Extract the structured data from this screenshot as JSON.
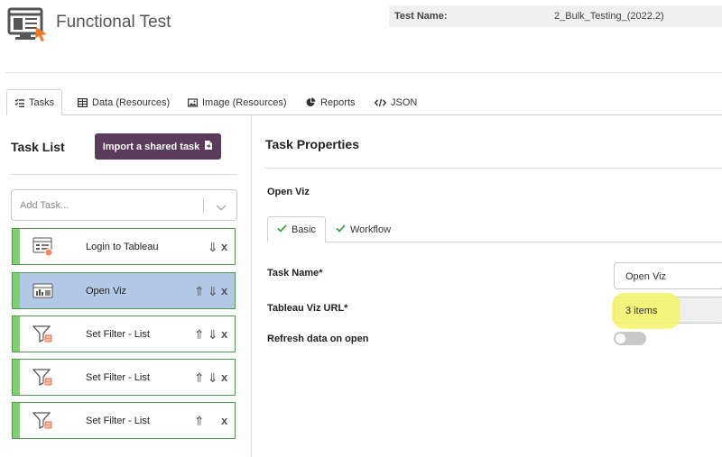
{
  "header": {
    "app_title": "Functional Test",
    "test_name_label": "Test Name:",
    "test_name_value": "2_Bulk_Testing_(2022.2)"
  },
  "tabs": [
    {
      "label": "Tasks",
      "icon": "tasks-list-icon"
    },
    {
      "label": "Data (Resources)",
      "icon": "table-icon"
    },
    {
      "label": "Image (Resources)",
      "icon": "image-icon"
    },
    {
      "label": "Reports",
      "icon": "pie-chart-icon"
    },
    {
      "label": "JSON",
      "icon": "code-icon"
    }
  ],
  "left_panel": {
    "title": "Task List",
    "import_button": "Import a shared task",
    "add_task_placeholder": "Add Task...",
    "tasks": [
      {
        "label": "Login to Tableau",
        "icon": "login-icon",
        "selected": false,
        "controls": [
          "down",
          "remove"
        ]
      },
      {
        "label": "Open Viz",
        "icon": "viz-icon",
        "selected": true,
        "controls": [
          "up",
          "down",
          "remove"
        ]
      },
      {
        "label": "Set Filter - List",
        "icon": "filter-icon",
        "selected": false,
        "controls": [
          "up",
          "down",
          "remove"
        ]
      },
      {
        "label": "Set Filter - List",
        "icon": "filter-icon",
        "selected": false,
        "controls": [
          "up",
          "down",
          "remove"
        ]
      },
      {
        "label": "Set Filter - List",
        "icon": "filter-icon",
        "selected": false,
        "controls": [
          "up",
          "remove"
        ]
      }
    ]
  },
  "right_panel": {
    "title": "Task Properties",
    "task_heading": "Open Viz",
    "subtabs": [
      {
        "label": "Basic",
        "active": true
      },
      {
        "label": "Workflow",
        "active": false
      }
    ],
    "fields": {
      "task_name_label": "Task Name*",
      "task_name_value": "Open Viz",
      "viz_url_label": "Tableau Viz URL*",
      "viz_url_value": "3 items",
      "refresh_label": "Refresh data on open",
      "refresh_on": false
    }
  },
  "colors": {
    "accent_purple": "#5b3a5c",
    "task_strip_green": "#7cd36e",
    "selected_task_blue": "#b3c8e6",
    "highlight_yellow": "#f3f567"
  }
}
